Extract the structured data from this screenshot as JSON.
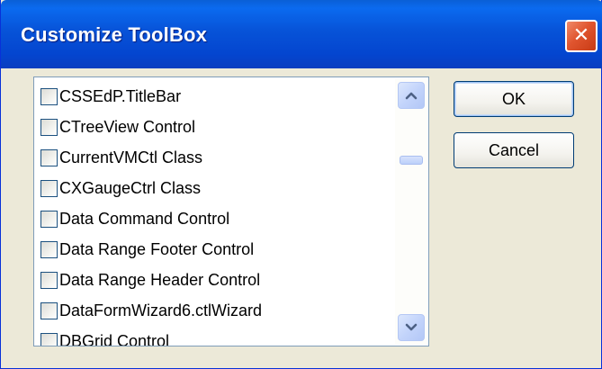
{
  "window": {
    "title": "Customize ToolBox",
    "close_glyph": "✕"
  },
  "list": {
    "items": [
      {
        "label": "CSSEdP.TitleBar",
        "checked": false
      },
      {
        "label": "CTreeView Control",
        "checked": false
      },
      {
        "label": "CurrentVMCtl Class",
        "checked": false
      },
      {
        "label": "CXGaugeCtrl Class",
        "checked": false
      },
      {
        "label": "Data Command Control",
        "checked": false
      },
      {
        "label": "Data Range Footer Control",
        "checked": false
      },
      {
        "label": "Data Range Header Control",
        "checked": false
      },
      {
        "label": "DataFormWizard6.ctlWizard",
        "checked": false
      },
      {
        "label": "DBGrid  Control",
        "checked": false
      }
    ]
  },
  "buttons": {
    "ok_label": "OK",
    "cancel_label": "Cancel"
  },
  "colors": {
    "title_bar": "#0753d8",
    "dialog_bg": "#ece9d8",
    "close_button": "#e0552f",
    "scroll_button": "#c3d4fb"
  },
  "icons": {
    "close": "close-icon",
    "scroll_up": "chevron-up-icon",
    "scroll_down": "chevron-down-icon"
  }
}
